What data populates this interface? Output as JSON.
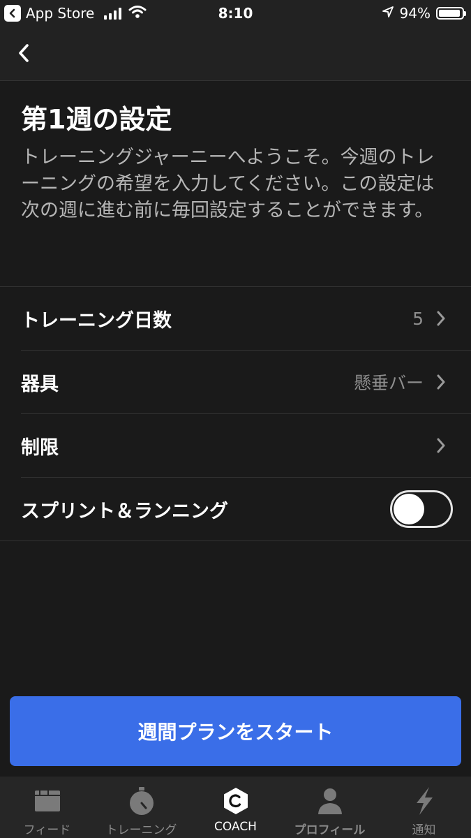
{
  "status_bar": {
    "back_app": "App Store",
    "time": "8:10",
    "battery": "94%",
    "battery_level": 0.94
  },
  "page": {
    "title": "第1週の設定",
    "description": "トレーニングジャーニーへようこそ。今週のトレーニングの希望を入力してください。この設定は次の週に進む前に毎回設定することができます。"
  },
  "settings": {
    "training_days": {
      "label": "トレーニング日数",
      "value": "5"
    },
    "equipment": {
      "label": "器具",
      "value": "懸垂バー"
    },
    "limits": {
      "label": "制限",
      "value": ""
    },
    "sprint_running": {
      "label": "スプリント＆ランニング",
      "enabled": false
    }
  },
  "start_button": {
    "label": "週間プランをスタート"
  },
  "tab_bar": {
    "feed": "フィード",
    "training": "トレーニング",
    "coach": "COACH",
    "profile": "プロフィール",
    "notifications": "通知",
    "active": "coach"
  },
  "colors": {
    "background": "#1a1a1a",
    "accent_button": "#3a6ee8",
    "tab_inactive": "#8a8a8a"
  },
  "icons": {
    "nav_back": "chevron-left-icon",
    "row_chevron": "chevron-right-icon",
    "feed": "feed-icon",
    "training": "stopwatch-icon",
    "coach": "coach-hexagon-icon",
    "profile": "person-icon",
    "notifications": "lightning-icon"
  }
}
